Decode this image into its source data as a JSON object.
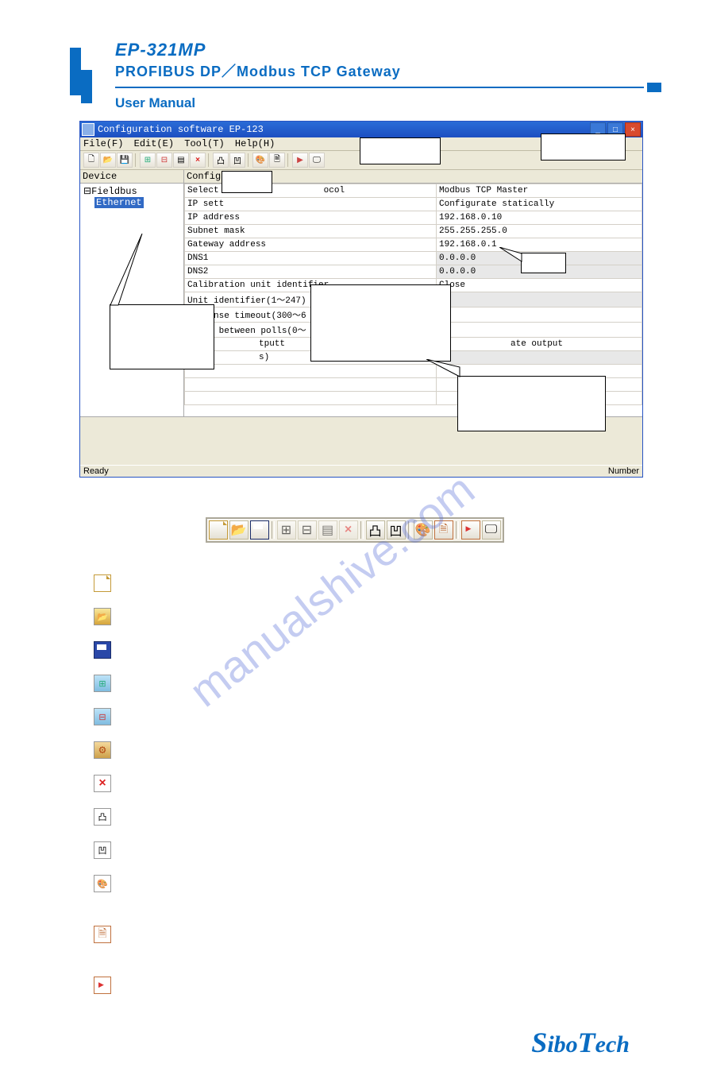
{
  "header": {
    "model": "EP-321MP",
    "subtitle": "PROFIBUS DP／Modbus TCP Gateway",
    "manual": "User Manual"
  },
  "window": {
    "title": "Configuration software EP-123",
    "menu": [
      "File(F)",
      "Edit(E)",
      "Tool(T)",
      "Help(H)"
    ],
    "toolbar": [
      "new",
      "open",
      "save",
      "addnode",
      "addchild",
      "prop",
      "del",
      "up",
      "dn",
      "conf",
      "doc",
      "export",
      "debug"
    ],
    "leftpane_header": "Device",
    "tree": {
      "root": "Fieldbus",
      "child": "Ethernet"
    },
    "rightpane_header": "Configuration",
    "rows": [
      {
        "k": "Select",
        "k2": "ocol",
        "v": "Modbus TCP Master"
      },
      {
        "k": "IP sett",
        "v": "Configurate statically"
      },
      {
        "k": "IP address",
        "v": "192.168.0.10"
      },
      {
        "k": "Subnet mask",
        "v": "255.255.255.0"
      },
      {
        "k": "Gateway address",
        "v": "192.168.0.1"
      },
      {
        "k": "DNS1",
        "v": "0.0.0.0",
        "grey": true
      },
      {
        "k": "DNS2",
        "v": "0.0.0.0",
        "grey": true
      },
      {
        "k": "Calibration unit identifier",
        "v": "Close"
      },
      {
        "k": "Unit identifier(1～247)",
        "v": "",
        "grey": true
      },
      {
        "k": "Response timeout(300～6",
        "v": ""
      },
      {
        "k": "Delay between polls(0～",
        "v": ""
      },
      {
        "k": "tputt",
        "v": "ate output"
      },
      {
        "k": "s)",
        "v": "",
        "grey": true
      }
    ],
    "status_left": "Ready",
    "status_right": "Number"
  },
  "iconbar": [
    "new",
    "open",
    "save",
    "addnode",
    "addchild",
    "prop",
    "del",
    "up",
    "dn",
    "conf",
    "doc",
    "export",
    "debug"
  ],
  "iconlist": [
    {
      "icon": "page",
      "label": ""
    },
    {
      "icon": "open",
      "label": ""
    },
    {
      "icon": "save",
      "label": ""
    },
    {
      "icon": "addnode",
      "label": ""
    },
    {
      "icon": "addchild",
      "label": ""
    },
    {
      "icon": "cfg",
      "label": ""
    },
    {
      "icon": "del",
      "label": ""
    },
    {
      "icon": "up",
      "label": ""
    },
    {
      "icon": "dn",
      "label": ""
    },
    {
      "icon": "conf",
      "label": ""
    },
    {
      "icon": "",
      "label": "",
      "gap": true
    },
    {
      "icon": "doc",
      "label": ""
    },
    {
      "icon": "",
      "label": "",
      "gap": true
    },
    {
      "icon": "pdf",
      "label": ""
    }
  ],
  "watermark": "manualshive.com",
  "footer": {
    "link": "",
    "logo": "SiboTech"
  }
}
